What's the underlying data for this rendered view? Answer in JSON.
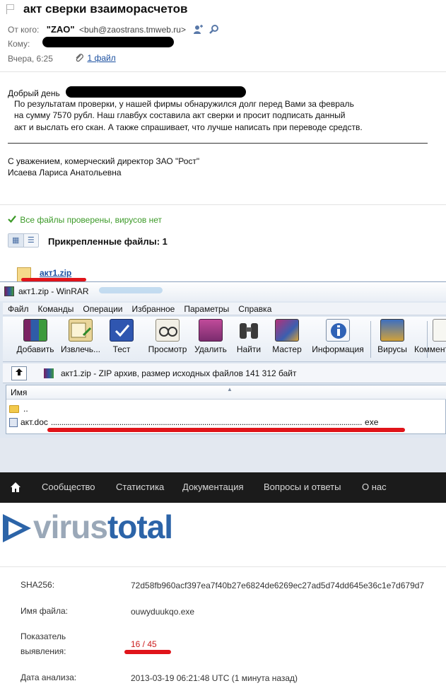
{
  "mail": {
    "subject": "акт сверки взаиморасчетов",
    "from_label": "От кого:",
    "from_name": "\"ZAO\"",
    "from_address": "<buh@zaostrans.tmweb.ru>",
    "to_label": "Кому:",
    "date": "Вчера, 6:25",
    "attachments_link": "1 файл",
    "greeting": "Добрый день",
    "body_lines": [
      "По результатам проверки, у нашей фирмы обнаружился долг перед Вами за февраль",
      "на сумму 7570 рубл. Наш главбух составила акт сверки и просит подписать данный",
      "акт и выслать его скан. А также спрашивает, что лучше написать при переводе средств."
    ],
    "signature_lines": [
      "С уважением, комерческий директор ЗАО \"Рост\"",
      "Исаева Лариса Анатольевна"
    ],
    "virus_check": "Все файлы проверены, вирусов нет",
    "attached_title": "Прикрепленные файлы: 1",
    "attachment_name": "акт1.zip"
  },
  "winrar": {
    "title": "акт1.zip - WinRAR",
    "menu": [
      "Файл",
      "Команды",
      "Операции",
      "Избранное",
      "Параметры",
      "Справка"
    ],
    "toolbar": [
      "Добавить",
      "Извлечь...",
      "Тест",
      "Просмотр",
      "Удалить",
      "Найти",
      "Мастер",
      "Информация",
      "Вирусы",
      "Коммент"
    ],
    "path_text": "акт1.zip - ZIP архив, размер исходных файлов 141 312 байт",
    "column_name": "Имя",
    "parent_row": "..",
    "file_row_start": "акт.doc",
    "file_row_dots": "......................................................................................................................................................",
    "file_row_end": "exe"
  },
  "virustotal": {
    "nav": [
      "Сообщество",
      "Статистика",
      "Документация",
      "Вопросы и ответы",
      "О нас"
    ],
    "logo_part1": "virus",
    "logo_part2": "total",
    "sha_label": "SHA256:",
    "sha_value": "72d58fb960acf397ea7f40b27e6824de6269ec27ad5d74dd645e36c1e7d679d7",
    "filename_label": "Имя файла:",
    "filename_value": "ouwyduukqo.exe",
    "detection_label_1": "Показатель",
    "detection_label_2": "выявления:",
    "detection_value": "16 / 45",
    "date_label": "Дата анализа:",
    "date_value": "2013-03-19 06:21:48 UTC (1 минута назад)"
  },
  "colors": {
    "vt_blue": "#2c64a8",
    "vt_gray": "#9aa8b8",
    "ok_green": "#3c9a28",
    "highlight_red": "#e0141a"
  }
}
